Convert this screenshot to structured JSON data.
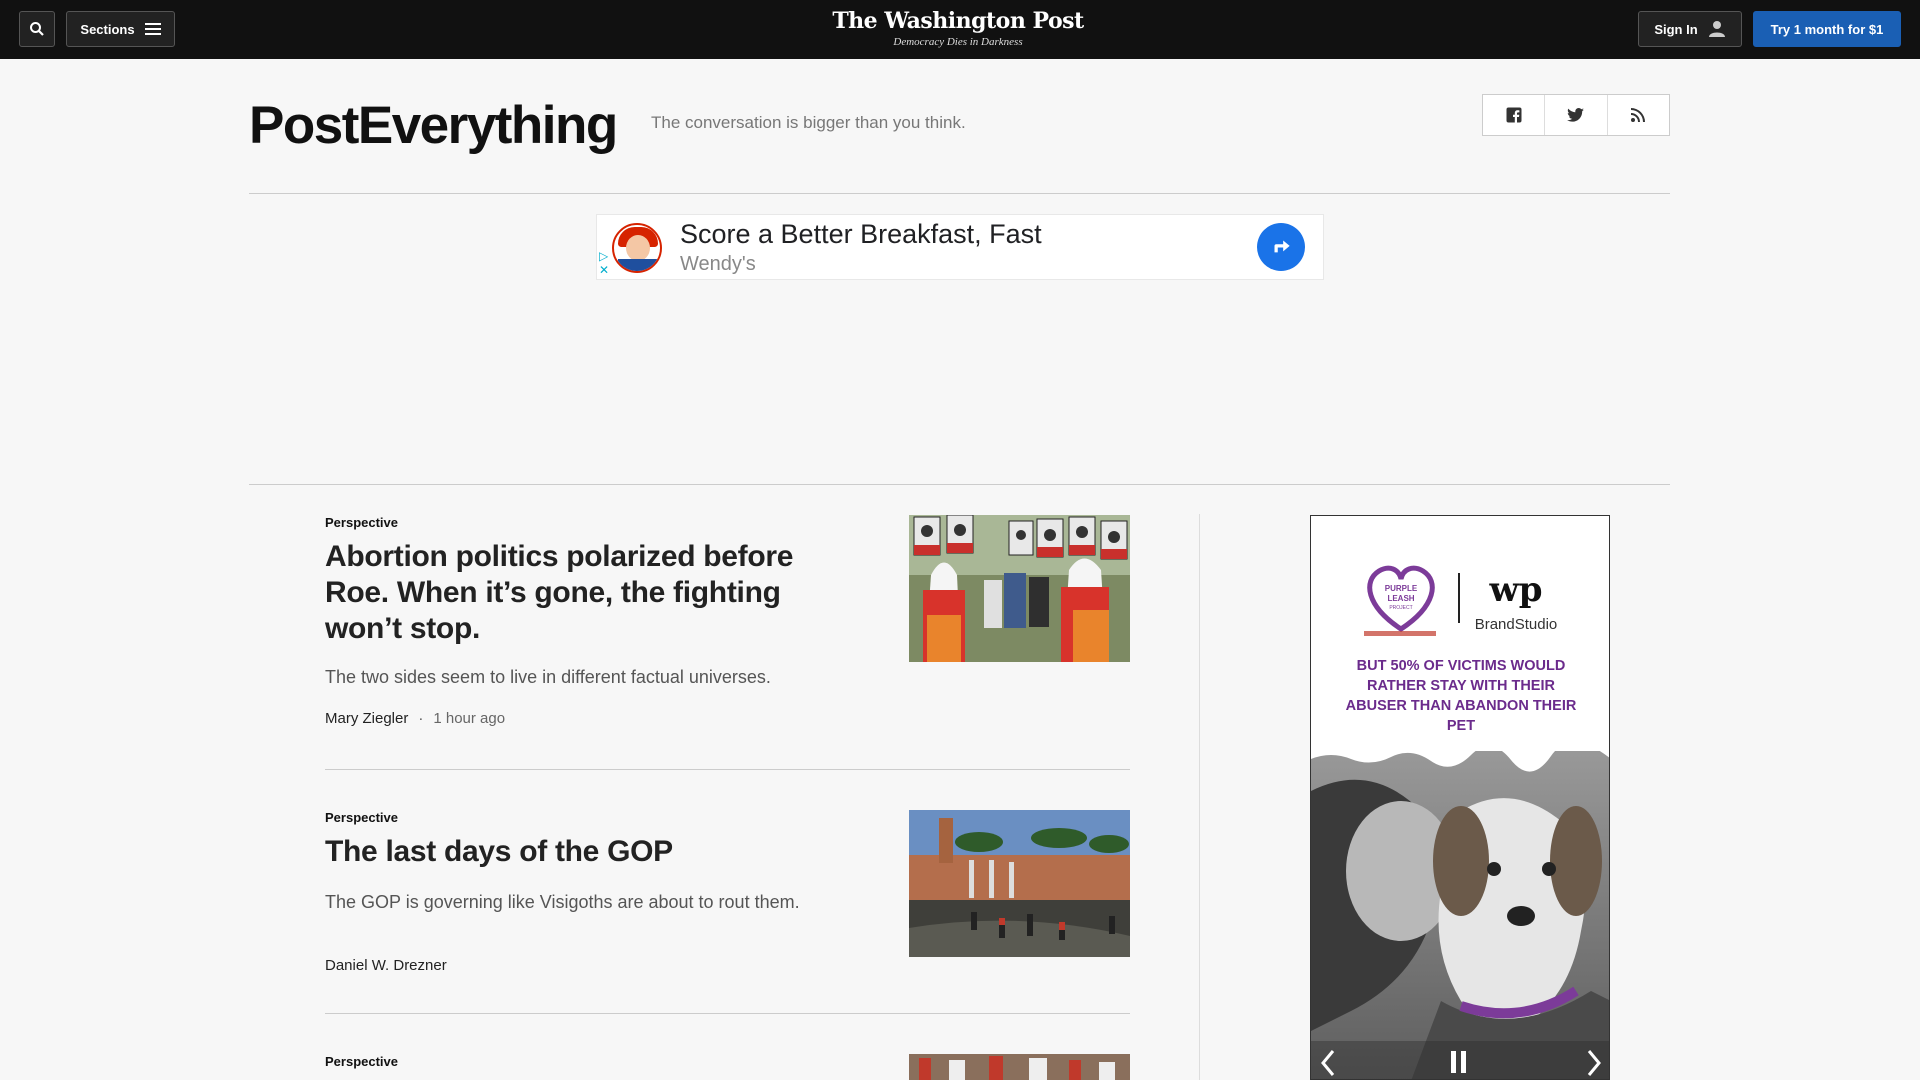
{
  "topbar": {
    "sections_label": "Sections",
    "logo": "The Washington Post",
    "tagline": "Democracy Dies in Darkness",
    "signin_label": "Sign In",
    "subscribe_label": "Try 1 month for $1"
  },
  "header": {
    "title": "PostEverything",
    "subtitle": "The conversation is bigger than you think.",
    "social": [
      "facebook-icon",
      "twitter-icon",
      "rss-icon"
    ]
  },
  "banner_ad": {
    "headline": "Score a Better Breakfast, Fast",
    "advertiser": "Wendy's"
  },
  "articles": [
    {
      "kicker": "Perspective",
      "headline": "Abortion politics polarized before Roe. When it’s gone, the fighting won’t stop.",
      "blurb": "The two sides seem to live in different factual universes.",
      "author": "Mary Ziegler",
      "time": "1 hour ago"
    },
    {
      "kicker": "Perspective",
      "headline": "The last days of the GOP",
      "blurb": "The GOP is governing like Visigoths are about to rout them.",
      "author": "Daniel W. Drezner"
    },
    {
      "kicker": "Perspective"
    }
  ],
  "side_ad": {
    "sponsor_left": "PURPLE LEASH PROJECT",
    "sponsor_right": "BrandStudio",
    "message": "BUT 50% OF VICTIMS WOULD RATHER STAY WITH THEIR ABUSER THAN ABANDON THEIR PET"
  },
  "colors": {
    "topbar": "#111111",
    "subscribe": "#1a5fb4",
    "ad_purple": "#6b2b8c"
  }
}
